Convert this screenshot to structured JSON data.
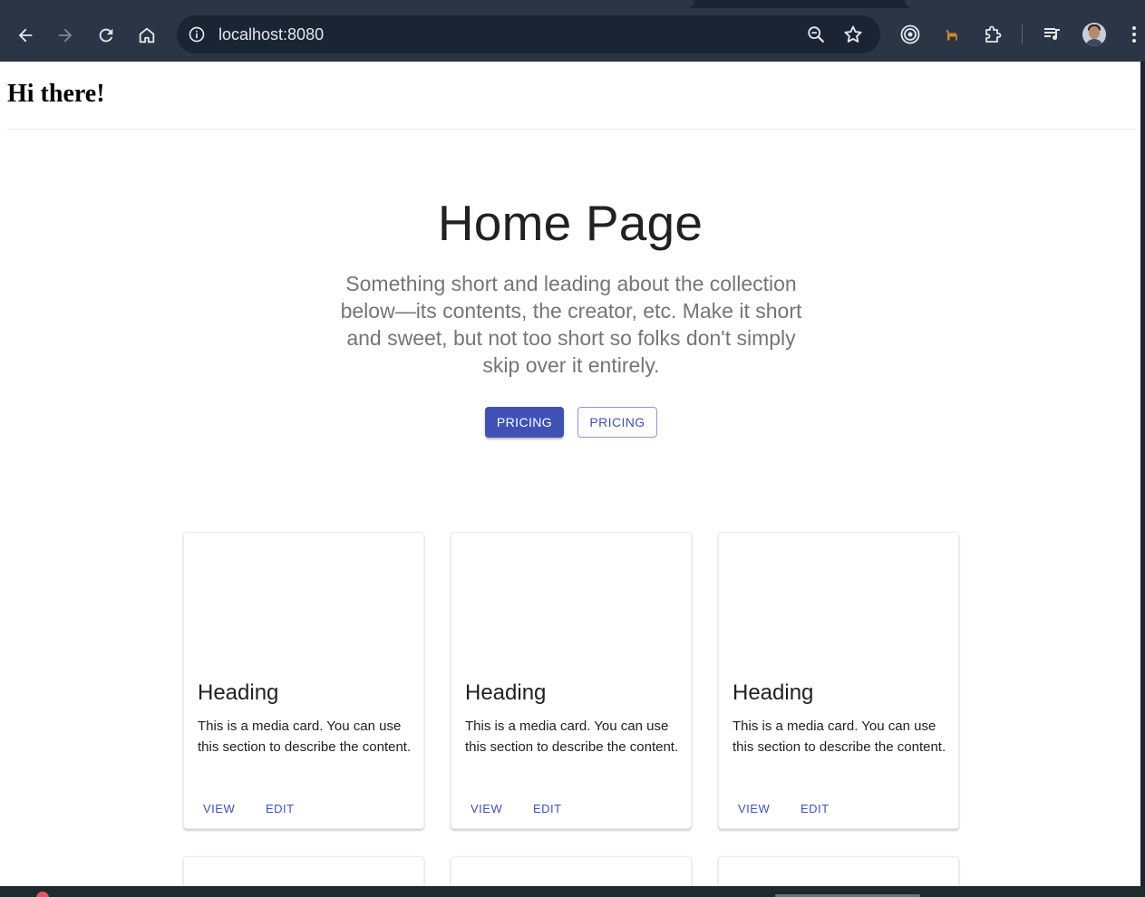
{
  "browser": {
    "url": "localhost:8080",
    "icons": {
      "back": "arrow-left-icon",
      "forward": "arrow-right-icon",
      "reload": "reload-icon",
      "home": "home-icon",
      "site_info": "info-icon",
      "zoom": "zoom-icon",
      "bookmark": "star-icon",
      "extension_1": "target-icon",
      "extension_2": "llama-icon",
      "extensions": "puzzle-icon",
      "media": "media-queue-icon",
      "profile": "avatar",
      "menu": "kebab-menu-icon"
    }
  },
  "page": {
    "greeting": "Hi there!",
    "hero": {
      "title": "Home Page",
      "description": "Something short and leading about the collection below—its contents, the creator, etc. Make it short and sweet, but not too short so folks don't simply skip over it entirely.",
      "primary_button": "Pricing",
      "secondary_button": "Pricing"
    },
    "cards": [
      {
        "heading": "Heading",
        "text": "This is a media card. You can use this section to describe the content.",
        "view": "View",
        "edit": "Edit"
      },
      {
        "heading": "Heading",
        "text": "This is a media card. You can use this section to describe the content.",
        "view": "View",
        "edit": "Edit"
      },
      {
        "heading": "Heading",
        "text": "This is a media card. You can use this section to describe the content.",
        "view": "View",
        "edit": "Edit"
      }
    ]
  },
  "colors": {
    "primary": "#3f51b5",
    "browser_toolbar": "#2b3546",
    "omnibox": "#1b2433",
    "title_text": "#212121",
    "muted_text": "#757575"
  }
}
